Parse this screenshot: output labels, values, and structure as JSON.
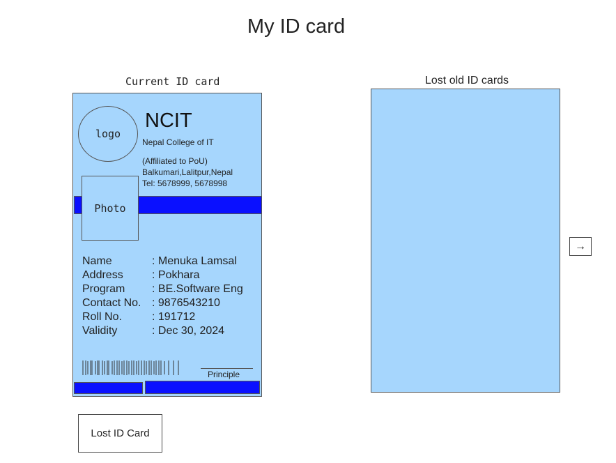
{
  "page": {
    "title": "My ID card"
  },
  "current_card": {
    "caption": "Current ID card",
    "logo_label": "logo",
    "college_short": "NCIT",
    "college_full": "Nepal College of IT",
    "affiliation": "(Affiliated to PoU)",
    "address": "Balkumari,Lalitpur,Nepal",
    "tel": "Tel: 5678999, 5678998",
    "photo_label": "Photo",
    "fields": [
      {
        "label": "Name",
        "value": ": Menuka Lamsal"
      },
      {
        "label": "Address",
        "value": ": Pokhara"
      },
      {
        "label": "Program",
        "value": ": BE.Software Eng"
      },
      {
        "label": "Contact No.",
        "value": ": 9876543210"
      },
      {
        "label": "Roll No.",
        "value": ": 191712"
      },
      {
        "label": "Validity",
        "value": ": Dec 30, 2024"
      }
    ],
    "signature_label": "Principle"
  },
  "lost_panel": {
    "caption": "Lost old ID cards"
  },
  "actions": {
    "next_icon": "arrow-right-icon",
    "lost_button_label": "Lost ID Card"
  },
  "colors": {
    "card_bg": "#a6d6fd",
    "band": "#0a10ff"
  }
}
